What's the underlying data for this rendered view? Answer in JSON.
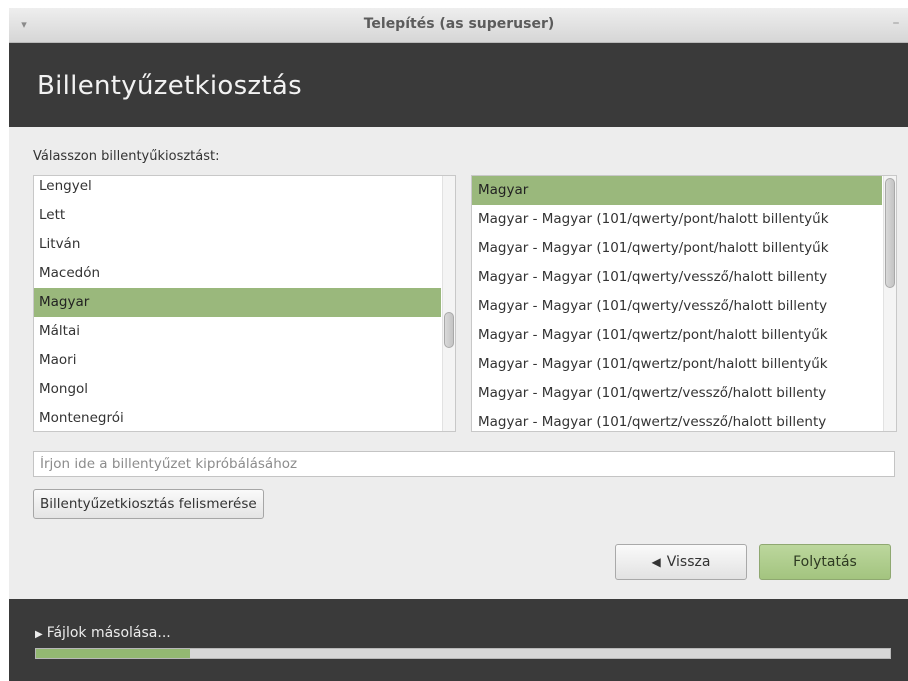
{
  "window": {
    "title": "Telepítés (as superuser)",
    "menu_icon": "dropdown-arrow-icon",
    "minimize_icon": "minimize-icon"
  },
  "header": {
    "title": "Billentyűzetkiosztás"
  },
  "content": {
    "prompt": "Válasszon billentyűkiosztást:",
    "layouts": [
      {
        "label": "Lengyel",
        "selected": false
      },
      {
        "label": "Lett",
        "selected": false
      },
      {
        "label": "Litván",
        "selected": false
      },
      {
        "label": "Macedón",
        "selected": false
      },
      {
        "label": "Magyar",
        "selected": true
      },
      {
        "label": "Máltai",
        "selected": false
      },
      {
        "label": "Maori",
        "selected": false
      },
      {
        "label": "Mongol",
        "selected": false
      },
      {
        "label": "Montenegrói",
        "selected": false
      }
    ],
    "variants": [
      {
        "label": "Magyar",
        "selected": true
      },
      {
        "label": "Magyar - Magyar (101/qwerty/pont/halott billentyűk",
        "selected": false
      },
      {
        "label": "Magyar - Magyar (101/qwerty/pont/halott billentyűk",
        "selected": false
      },
      {
        "label": "Magyar - Magyar (101/qwerty/vessző/halott billenty",
        "selected": false
      },
      {
        "label": "Magyar - Magyar (101/qwerty/vessző/halott billenty",
        "selected": false
      },
      {
        "label": "Magyar - Magyar (101/qwertz/pont/halott billentyűk",
        "selected": false
      },
      {
        "label": "Magyar - Magyar (101/qwertz/pont/halott billentyűk",
        "selected": false
      },
      {
        "label": "Magyar - Magyar (101/qwertz/vessző/halott billenty",
        "selected": false
      },
      {
        "label": "Magyar - Magyar (101/qwertz/vessző/halott billenty",
        "selected": false
      }
    ],
    "test_input": {
      "value": "",
      "placeholder": "Írjon ide a billentyűzet kipróbálásához"
    },
    "detect_label": "Billentyűzetkiosztás felismerése"
  },
  "buttons": {
    "back_label": "Vissza",
    "back_icon": "back-arrow-icon",
    "next_label": "Folytatás"
  },
  "footer": {
    "status": "Fájlok másolása...",
    "status_icon": "expander-triangle-icon",
    "progress_fraction": 0.18
  },
  "colors": {
    "selection": "#9ab87c",
    "accent_button": "#a3c47f",
    "header_bg": "#3a3a3a"
  }
}
